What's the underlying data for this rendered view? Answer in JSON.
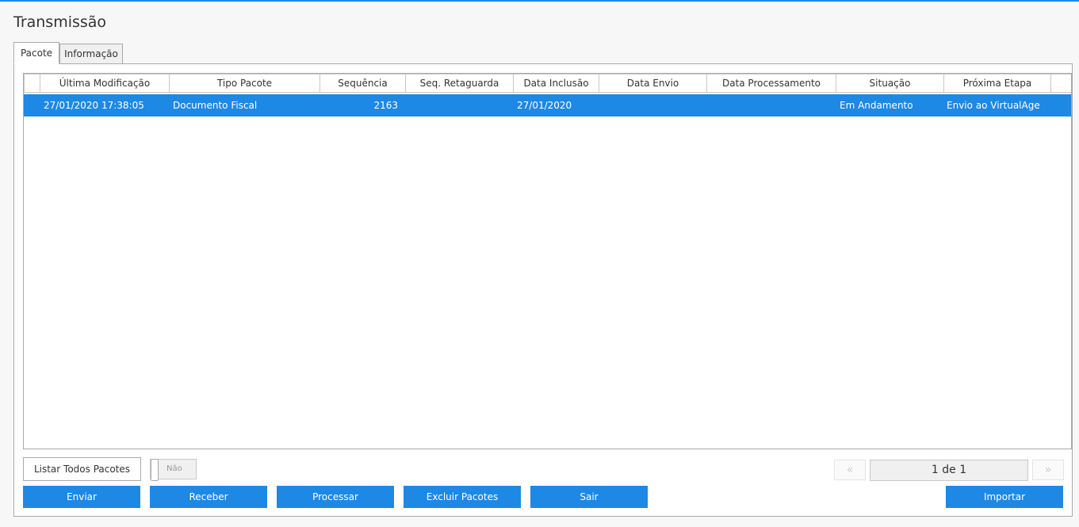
{
  "page": {
    "title": "Transmissão"
  },
  "tabs": [
    {
      "label": "Pacote",
      "active": true
    },
    {
      "label": "Informação",
      "active": false
    }
  ],
  "grid": {
    "columns": [
      "",
      "Última Modificação",
      "Tipo Pacote",
      "Sequência",
      "Seq. Retaguarda",
      "Data Inclusão",
      "Data Envio",
      "Data Processamento",
      "Situação",
      "Próxima Etapa",
      ""
    ],
    "rows": [
      {
        "ultima_modificacao": "27/01/2020 17:38:05",
        "tipo_pacote": "Documento Fiscal",
        "sequencia": "2163",
        "seq_retaguarda": "",
        "data_inclusao": "27/01/2020",
        "data_envio": "",
        "data_processamento": "",
        "situacao": "Em Andamento",
        "proxima_etapa": "Envio ao VirtualAge",
        "selected": true
      }
    ]
  },
  "controls": {
    "listar_label": "Listar Todos Pacotes",
    "toggle_label": "Não",
    "pager_prev": "«",
    "pager_info": "1 de 1",
    "pager_next": "»"
  },
  "actions": {
    "enviar": "Enviar",
    "receber": "Receber",
    "processar": "Processar",
    "excluir": "Excluir Pacotes",
    "sair": "Sair",
    "importar": "Importar"
  },
  "colors": {
    "accent": "#1e88e5",
    "border": "#a9a9a9"
  }
}
